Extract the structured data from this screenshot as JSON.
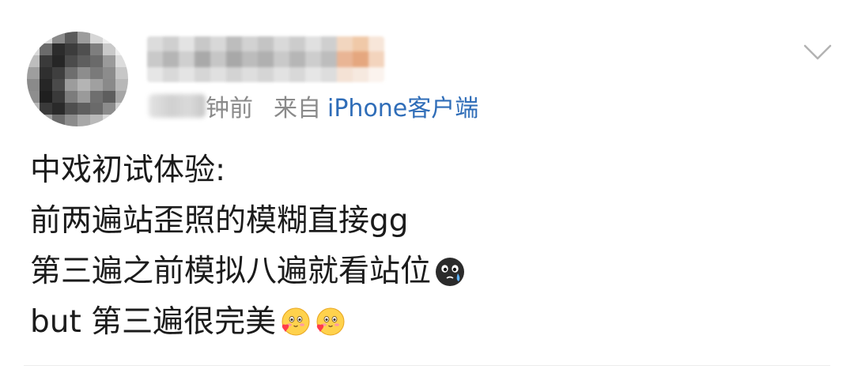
{
  "post": {
    "time_suffix": "钟前",
    "from_label": "来自",
    "client": "iPhone客户端",
    "lines": [
      "中戏初试体验:",
      "前两遍站歪照的模糊直接gg",
      "第三遍之前模拟八遍就看站位",
      "but 第三遍很完美"
    ],
    "emojis": {
      "line3": "crying-face-emoji",
      "line4": [
        "heart-cheeks-emoji",
        "heart-cheeks-emoji"
      ]
    }
  },
  "icons": {
    "more": "chevron-down-icon"
  },
  "colors": {
    "text": "#1b1b1b",
    "meta": "#8a8a8a",
    "client_link": "#2f6db8"
  }
}
